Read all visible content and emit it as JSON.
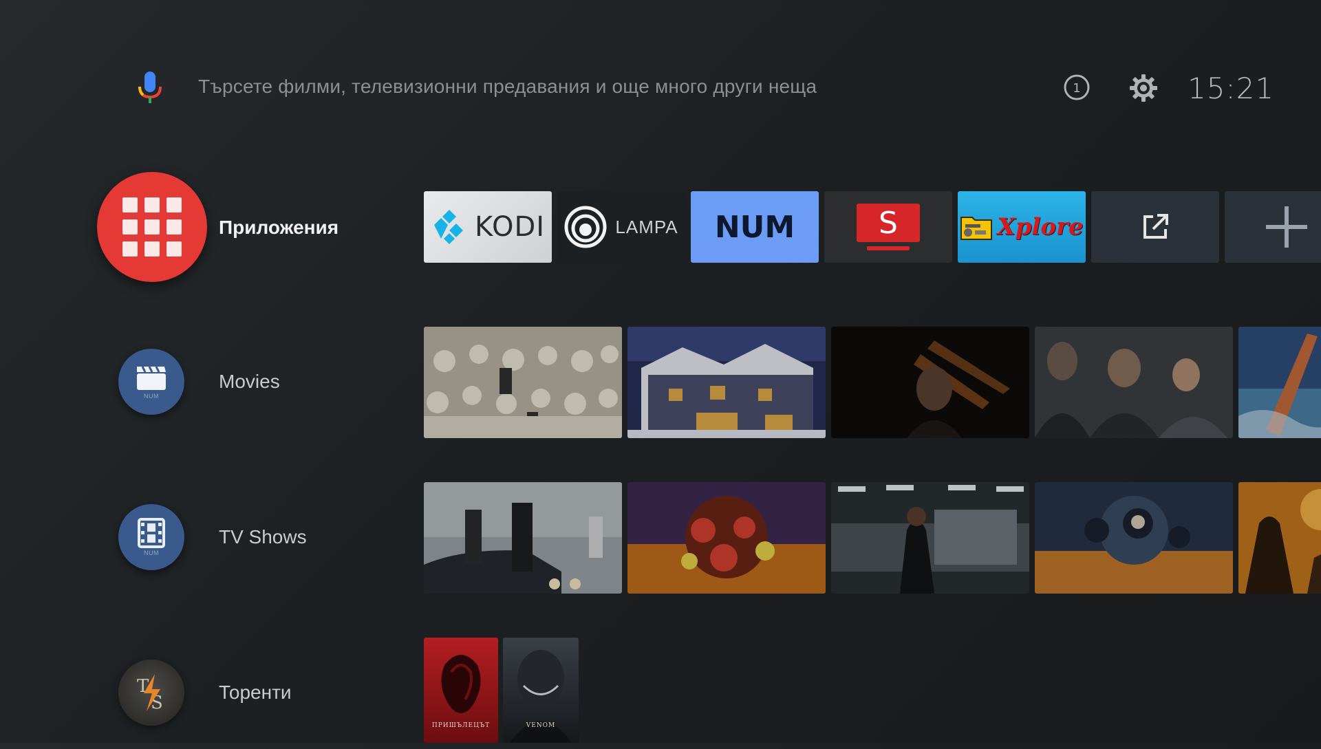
{
  "search": {
    "placeholder": "Търсете филми, телевизионни предавания и още много други неща",
    "mic_icon": "mic-icon"
  },
  "status": {
    "notification_count": "1",
    "clock": "15:21"
  },
  "apps_row": {
    "label": "Приложения",
    "accent": "#e53935",
    "apps": [
      {
        "name": "KODI",
        "icon": "kodi-logo"
      },
      {
        "name": "LAMPA",
        "icon": "lampa-logo"
      },
      {
        "name": "NUM",
        "icon": "num-logo"
      },
      {
        "name": "S",
        "icon": "s-app-logo"
      },
      {
        "name": "Xplore",
        "icon": "xplore-logo"
      },
      {
        "name": "",
        "icon": "open-external-icon"
      },
      {
        "name": "",
        "icon": "add-icon"
      }
    ]
  },
  "rows": [
    {
      "label": "Movies",
      "icon": "clapperboard-icon",
      "badge": "NUM"
    },
    {
      "label": "TV Shows",
      "icon": "film-icon",
      "badge": "NUM"
    },
    {
      "label": "Торенти",
      "icon": "torrserve-icon"
    }
  ],
  "torrents": {
    "poster1_title": "ПРИШЪЛЕЦЪТ",
    "poster2_title": "VENOM"
  }
}
